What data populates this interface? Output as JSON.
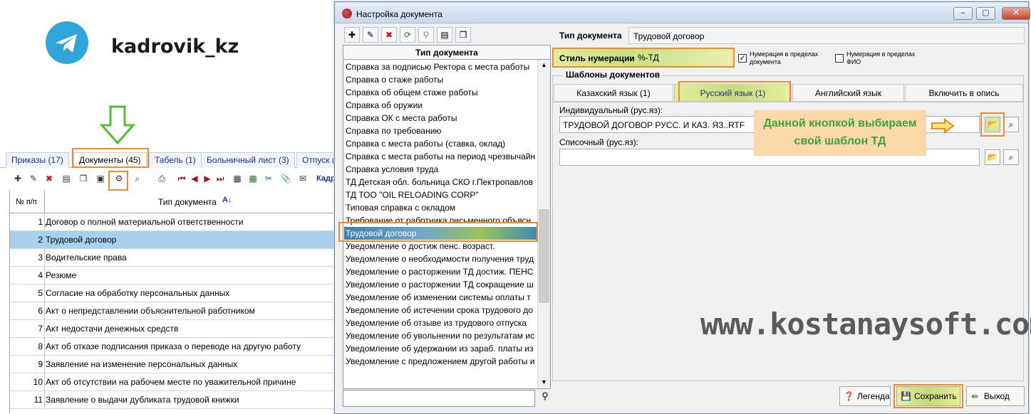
{
  "brand": {
    "name": "kadrovik_kz",
    "logo_icon": "telegram-icon"
  },
  "left_tabs": [
    {
      "label": "Приказы (17)"
    },
    {
      "label": "Документы (45)"
    },
    {
      "label": "Табель (1)"
    },
    {
      "label": "Больничный лист (3)"
    },
    {
      "label": "Отпуск ("
    }
  ],
  "left_toolbar": {
    "more": "Кадр"
  },
  "left_grid": {
    "col_num": "№ п/п",
    "col_type": "Тип документа",
    "rows": [
      {
        "num": "1",
        "text": "Договор о полной материальной ответственности"
      },
      {
        "num": "2",
        "text": "Трудовой договор"
      },
      {
        "num": "3",
        "text": "Водительские права"
      },
      {
        "num": "4",
        "text": "Резюме"
      },
      {
        "num": "5",
        "text": "Согласие на обработку персональных данных"
      },
      {
        "num": "6",
        "text": "Акт о непредставлении объяснительной работником"
      },
      {
        "num": "7",
        "text": "Акт недостачи денежных средств"
      },
      {
        "num": "8",
        "text": "Акт об отказе подписания приказа о переводе на другую работу"
      },
      {
        "num": "9",
        "text": "Заявление на изменение персональных данных"
      },
      {
        "num": "10",
        "text": "Акт об отсутствии на рабочем месте по уважительной причине"
      },
      {
        "num": "11",
        "text": "Заявление о выдачи дубликата трудовой книжки"
      }
    ]
  },
  "dialog": {
    "title": "Настройка документа",
    "doclist_header": "Тип документа",
    "doclist": [
      "Справка за подписью Ректора с места работы",
      "Справка о стаже работы",
      "Справка об общем стаже работы",
      "Справка об оружии",
      "Справка ОК с места работы",
      "Справка по требованию",
      "Справка с места работы (ставка, оклад)",
      "Справка с места работы на период чрезвычайн",
      "Справка условия труда",
      "ТД Детская обл. больница СКО г.Пектропавлов",
      "ТД ТОО \"OIL RELOADING CORP\"",
      "Типовая справка с окладом",
      "Требование от работника письменного объясн",
      "Трудовой договор",
      "Уведомление о достиж пенс. возраст.",
      "Уведомление о необходимости получения труд",
      "Уведомление о расторжении ТД достиж. ПЕНС",
      "Уведомление о расторжении ТД сокращение ш",
      "Уведомление об изменении системы оплаты т",
      "Уведомление об истечении срока трудового до",
      "Уведомление об отзыве из трудового отпуска",
      "Уведомление об увольнении по результатам ис",
      "Уведомление об удержании из зараб. платы из",
      "Уведомление с предложением другой работы и"
    ],
    "doc_type_label": "Тип документа",
    "doc_type_value": "Трудовой договор",
    "num_style_label": "Стиль нумерации",
    "num_style_value": "%-ТД",
    "chk1_label_1": "Нумерация в пределах",
    "chk1_label_2": "документа",
    "chk2_label_1": "Нумерация в пределах",
    "chk2_label_2": "ФИО",
    "templates_title": "Шаблоны документов",
    "tabs": [
      "Казахский язык (1)",
      "Русский язык (1)",
      "Английский язык",
      "Включить в опись"
    ],
    "indiv_label": "Индивидуальный (рус.яз):",
    "indiv_value": "ТРУДОВОЙ ДОГОВОР РУСС. И КАЗ. ЯЗ..RTF",
    "list_label": "Списочный (рус.яз):",
    "callout_1": "Данной кнопкой выбираем",
    "callout_2": "свой шаблон ТД",
    "legend_btn": "Легенда",
    "save_btn": "Сохранить",
    "exit_btn": "Выход"
  },
  "watermark": "www.kostanaysoft.com",
  "colors": {
    "highlight": "#f08a2a",
    "selection": "#a9d1ee",
    "telegram": "#2ea6d9"
  }
}
